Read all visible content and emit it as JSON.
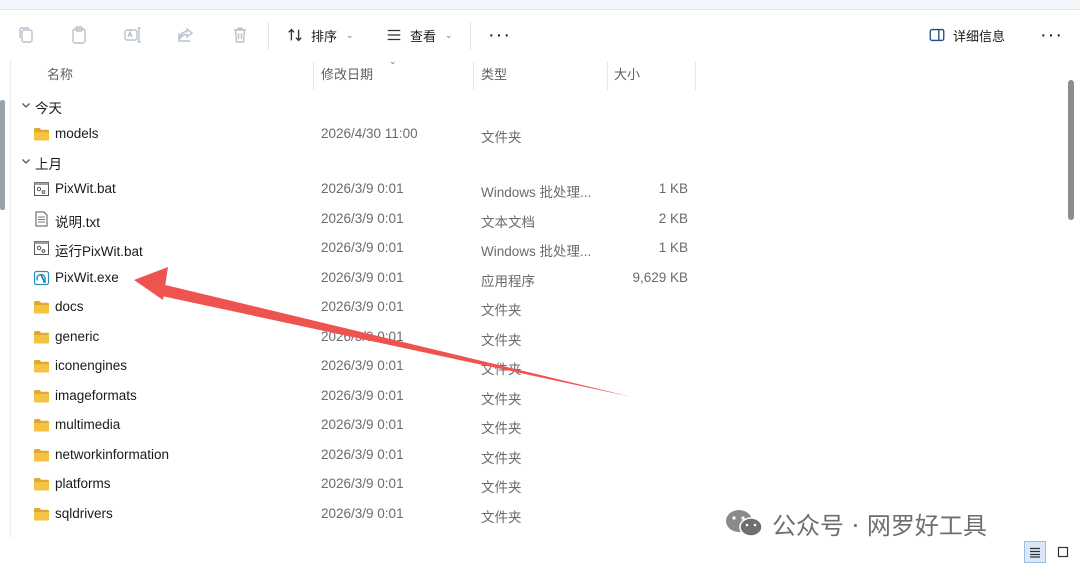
{
  "toolbar": {
    "sort_label": "排序",
    "view_label": "查看",
    "more_label": "···",
    "details_label": "详细信息",
    "right_more_label": "···"
  },
  "columns": {
    "name": "名称",
    "date": "修改日期",
    "type": "类型",
    "size": "大小"
  },
  "groups": {
    "today": "今天",
    "last_month": "上月"
  },
  "files": [
    {
      "name": "models",
      "date": "2026/4/30 11:00",
      "type": "文件夹",
      "size": "",
      "icon": "folder-icon"
    },
    {
      "name": "PixWit.bat",
      "date": "2026/3/9 0:01",
      "type": "Windows 批处理...",
      "size": "1 KB",
      "icon": "batch-file-icon"
    },
    {
      "name": "说明.txt",
      "date": "2026/3/9 0:01",
      "type": "文本文档",
      "size": "2 KB",
      "icon": "text-file-icon"
    },
    {
      "name": "运行PixWit.bat",
      "date": "2026/3/9 0:01",
      "type": "Windows 批处理...",
      "size": "1 KB",
      "icon": "batch-file-icon"
    },
    {
      "name": "PixWit.exe",
      "date": "2026/3/9 0:01",
      "type": "应用程序",
      "size": "9,629 KB",
      "icon": "app-exe-icon"
    },
    {
      "name": "docs",
      "date": "2026/3/9 0:01",
      "type": "文件夹",
      "size": "",
      "icon": "folder-icon"
    },
    {
      "name": "generic",
      "date": "2026/3/9 0:01",
      "type": "文件夹",
      "size": "",
      "icon": "folder-icon"
    },
    {
      "name": "iconengines",
      "date": "2026/3/9 0:01",
      "type": "文件夹",
      "size": "",
      "icon": "folder-icon"
    },
    {
      "name": "imageformats",
      "date": "2026/3/9 0:01",
      "type": "文件夹",
      "size": "",
      "icon": "folder-icon"
    },
    {
      "name": "multimedia",
      "date": "2026/3/9 0:01",
      "type": "文件夹",
      "size": "",
      "icon": "folder-icon"
    },
    {
      "name": "networkinformation",
      "date": "2026/3/9 0:01",
      "type": "文件夹",
      "size": "",
      "icon": "folder-icon"
    },
    {
      "name": "platforms",
      "date": "2026/3/9 0:01",
      "type": "文件夹",
      "size": "",
      "icon": "folder-icon"
    },
    {
      "name": "sqldrivers",
      "date": "2026/3/9 0:01",
      "type": "文件夹",
      "size": "",
      "icon": "folder-icon"
    }
  ],
  "watermark": {
    "text": "公众号 · 网罗好工具"
  },
  "colors": {
    "folder": "#f5c242",
    "folder_dark": "#e0a82e",
    "annotation_arrow": "#ef5350",
    "accent": "#1a73e8"
  }
}
